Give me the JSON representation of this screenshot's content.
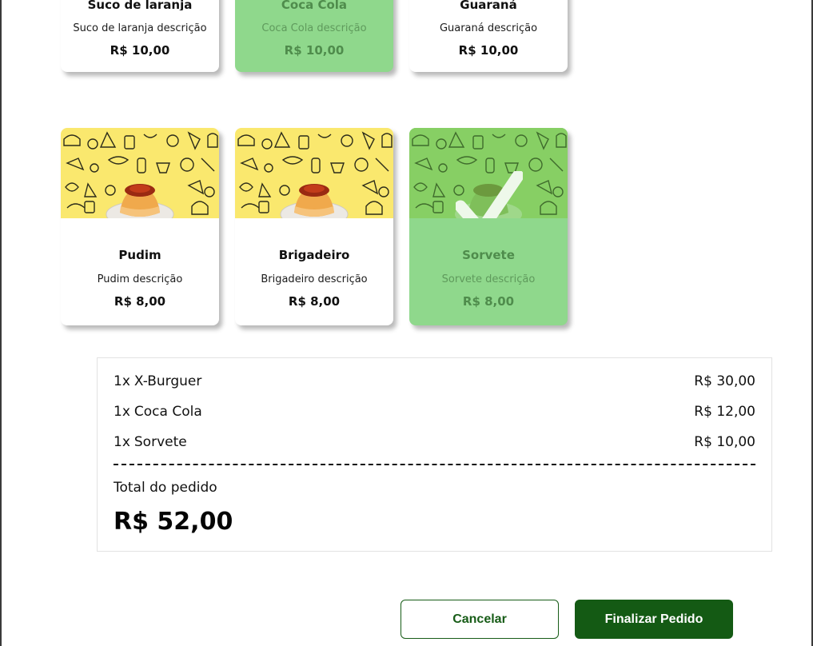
{
  "drinks": [
    {
      "name": "Suco de laranja",
      "description": "Suco de laranja descrição",
      "price": "R$ 10,00",
      "selected": false
    },
    {
      "name": "Coca Cola",
      "description": "Coca Cola descrição",
      "price": "R$ 10,00",
      "selected": true
    },
    {
      "name": "Guaraná",
      "description": "Guaraná descrição",
      "price": "R$ 10,00",
      "selected": false
    }
  ],
  "desserts": [
    {
      "name": "Pudim",
      "description": "Pudim descrição",
      "price": "R$ 8,00",
      "selected": false,
      "image_icon": "pudding-icon"
    },
    {
      "name": "Brigadeiro",
      "description": "Brigadeiro descrição",
      "price": "R$ 8,00",
      "selected": false,
      "image_icon": "pudding-icon"
    },
    {
      "name": "Sorvete",
      "description": "Sorvete descrição",
      "price": "R$ 8,00",
      "selected": true,
      "image_icon": "checkmark-icon"
    }
  ],
  "order": {
    "items": [
      {
        "qty": "1x",
        "name": "X-Burguer",
        "price": "R$ 30,00"
      },
      {
        "qty": "1x",
        "name": "Coca Cola",
        "price": "R$ 12,00"
      },
      {
        "qty": "1x",
        "name": "Sorvete",
        "price": "R$ 10,00"
      }
    ],
    "total_label": "Total do pedido",
    "total_value": "R$ 52,00"
  },
  "actions": {
    "cancel_label": "Cancelar",
    "finish_label": "Finalizar Pedido"
  },
  "colors": {
    "selected_card": "#8fd88c",
    "thumb_yellow": "#fae86e",
    "thumb_green": "#87cf64",
    "primary_button": "#145a14"
  }
}
